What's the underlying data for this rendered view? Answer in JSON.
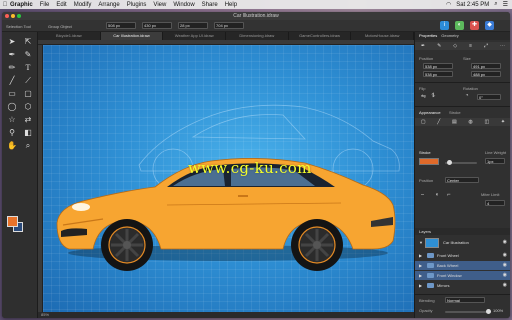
{
  "menubar": {
    "app_name": "Graphic",
    "items": [
      "File",
      "Edit",
      "Modify",
      "Arrange",
      "Plugins",
      "View",
      "Window",
      "Share",
      "Help"
    ],
    "clock": "Sat 2:45 PM"
  },
  "window": {
    "title": "Car Illustration.idraw"
  },
  "toolbar": {
    "selection_tool_label": "Selection Tool",
    "group_label": "Group Object",
    "x_value": "508 px",
    "y_value": "430 px",
    "w_value": "28 px",
    "h_value": "704 px"
  },
  "tabs": [
    {
      "label": "Bicycle1.idraw",
      "active": false
    },
    {
      "label": "Car Illustration.idraw",
      "active": true
    },
    {
      "label": "Weather App UI.idraw",
      "active": false
    },
    {
      "label": "Dimensioning.idraw",
      "active": false
    },
    {
      "label": "GameControllers.idraw",
      "active": false
    },
    {
      "label": "MotorsHouse.idraw",
      "active": false
    }
  ],
  "canvas": {
    "watermark": "www.cg-ku.com",
    "background_color": "#2e8fd4",
    "car_color": "#f7a531"
  },
  "statusbar": {
    "zoom": "85%"
  },
  "inspector": {
    "tabs": [
      "Properties",
      "Geometry"
    ],
    "position_label": "Position",
    "size_label": "Size",
    "pos_x": "538 px",
    "pos_y": "538 px",
    "size_w": "491 px",
    "size_h": "488 px",
    "flip_label": "Flip",
    "rotation_label": "Rotation",
    "rotation_value": "0°",
    "appearance_label": "Appearance",
    "stroke_tab_label": "Stroke",
    "stroke_label": "Stroke",
    "line_weight_label": "Line Weight",
    "line_weight_value": "1px",
    "position2_label": "Position",
    "position2_value": "Center",
    "miter_label": "Miter Limit",
    "miter_value": "4",
    "stroke_color": "#e06a2a",
    "layers_label": "Layers",
    "layers": [
      {
        "name": "Car Illustration",
        "selected": false,
        "thumb": true
      },
      {
        "name": "Front Wheel",
        "selected": false
      },
      {
        "name": "Back Wheel",
        "selected": true
      },
      {
        "name": "Front Window",
        "selected": true
      },
      {
        "name": "Mirrors",
        "selected": false
      }
    ],
    "blending_label": "Blending",
    "blending_value": "Normal",
    "opacity_label": "Opacity",
    "opacity_value": "100%"
  }
}
